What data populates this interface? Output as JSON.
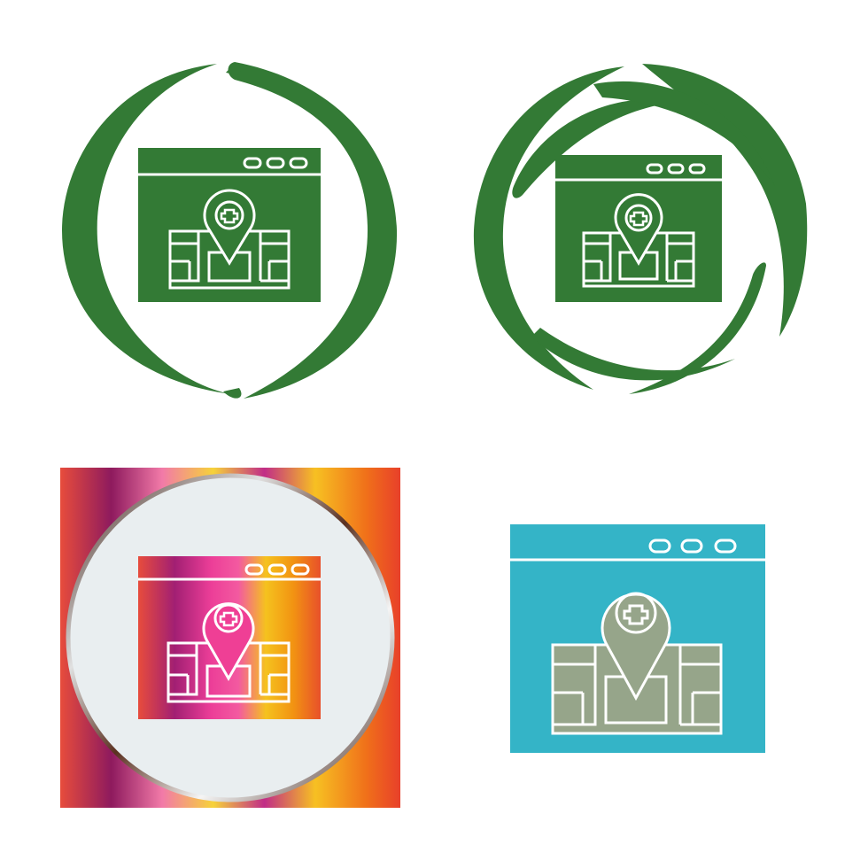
{
  "icons": [
    {
      "name": "map-location-icon-green-circle",
      "style": "glyph-in-ring",
      "color": "#337a35"
    },
    {
      "name": "map-location-icon-green-swirl",
      "style": "glyph-in-swirl",
      "color": "#337a35"
    },
    {
      "name": "map-location-icon-gradient",
      "style": "gradient-square",
      "gradient_colors": [
        "#e74c3c",
        "#9b1f6a",
        "#f04aa8",
        "#f6d23a",
        "#f28a1a",
        "#e8502a"
      ],
      "disc_color": "#e9eef0"
    },
    {
      "name": "map-location-icon-flat",
      "style": "flat-color",
      "window_color": "#34b4c7",
      "map_color": "#96a58a"
    }
  ]
}
